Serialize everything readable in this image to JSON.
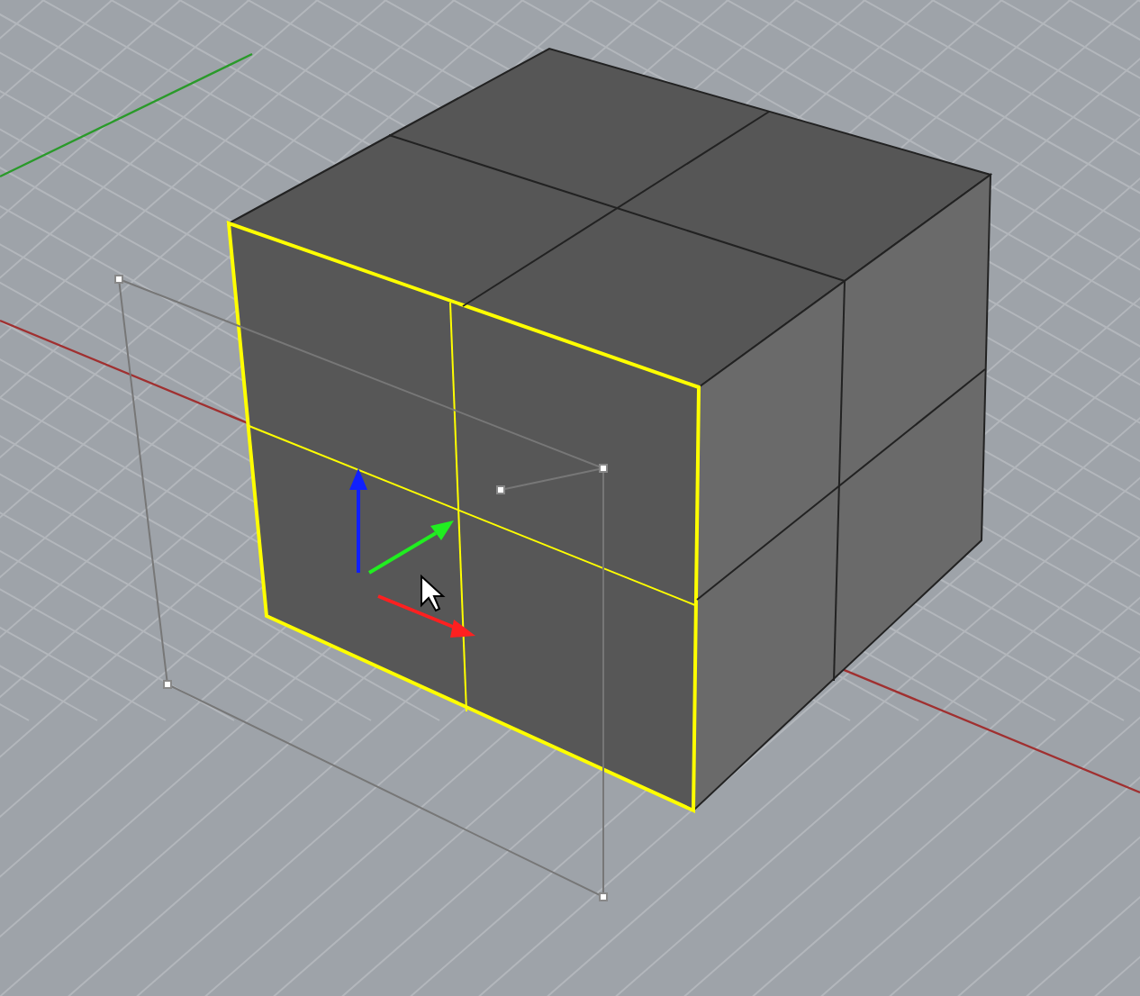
{
  "viewport": {
    "grid": true,
    "face_selected": true,
    "gizmo": true
  }
}
